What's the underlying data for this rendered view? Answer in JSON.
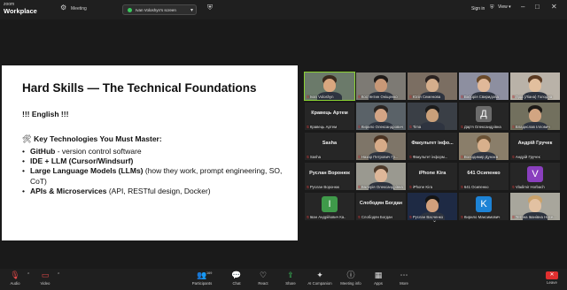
{
  "app": {
    "brand_small": "zoom",
    "brand_big": "Workplace",
    "meeting_label": "Meeting"
  },
  "share_banner": {
    "text": "Ivan Voloshyn's screen"
  },
  "header_right": {
    "signin": "Sign in",
    "view": "View"
  },
  "slide": {
    "title": "Hard Skills — The Technical Foundations",
    "english": "!!! English !!!",
    "subtitle_icon": "🛠",
    "subtitle": "Key Technologies You Must Master:",
    "bullets": [
      {
        "bold": "GitHub",
        "rest": " - version control software"
      },
      {
        "bold": "IDE + LLM (Cursor/Windsurf)",
        "rest": ""
      },
      {
        "bold": "Large Language Models (LLMs)",
        "rest": " (how they work, prompt engineering, SO, CoT)"
      },
      {
        "bold": "APIs & Microservices",
        "rest": " (API, RESTful design, Docker)"
      }
    ]
  },
  "participants": [
    {
      "name": "Ivan Voloshyn",
      "speaker": true
    },
    {
      "name": "Костянтин Оніщенко"
    },
    {
      "name": "Юлія Семенова"
    },
    {
      "name": "Вікторія Свиридова"
    },
    {
      "name": "Ліда (Ліана) Голодна"
    },
    {
      "name": "Кравець Артем",
      "center": "Кравець Артем"
    },
    {
      "name": "Кирило Олександрович"
    },
    {
      "name": "Tima"
    },
    {
      "name": "Дар'я Олександрівна",
      "avatar": "Д"
    },
    {
      "name": "Владислав Іллович"
    },
    {
      "name": "Sasha",
      "center": "Sasha"
    },
    {
      "name": "Назар Петрович Гр..."
    },
    {
      "name": "Факультет інформ...",
      "center": "Факультет інфо..."
    },
    {
      "name": "Володимир Дунаєв"
    },
    {
      "name": "Андрій Гручек",
      "center": "Андрій Гручек"
    },
    {
      "name": "Руслан Воронюк",
      "center": "Руслан Воронюк"
    },
    {
      "name": "Валерія Олександрівна"
    },
    {
      "name": "iPhone Kira",
      "center": "iPhone Kira"
    },
    {
      "name": "641 Осипенко",
      "center": "641 Осипенко"
    },
    {
      "name": "Vladimir Horbach",
      "avatar": "V"
    },
    {
      "name": "Іван Андрійович Ка..",
      "avatar": "I"
    },
    {
      "name": "Слободян Богдан",
      "center": "Слободян Богдан"
    },
    {
      "name": "Руслан Васченко"
    },
    {
      "name": "Кирило Максимович",
      "avatar": "K"
    },
    {
      "name": "Тетяна Іванівна Носе..."
    }
  ],
  "toolbar": {
    "audio": "Audio",
    "video": "Video",
    "participants": "Participants",
    "participants_count": "169",
    "chat": "Chat",
    "react": "React",
    "share": "Share",
    "ai_companion": "AI Companion",
    "meeting_info": "Meeting info",
    "apps": "Apps",
    "more": "More",
    "leave": "Leave"
  },
  "icons": [
    "zoom-logo-icon",
    "gear-icon",
    "shield-icon",
    "minimize-icon",
    "maximize-icon",
    "close-icon",
    "mic-muted-icon",
    "video-off-icon",
    "participants-icon",
    "chat-icon",
    "react-icon",
    "share-icon",
    "ai-companion-icon",
    "info-icon",
    "apps-icon",
    "more-icon",
    "chevron-down-icon"
  ],
  "colors": {
    "speaker_outline": "#8ad232",
    "leave": "#e02f2f",
    "muted": "#e04848",
    "share": "#3ac95e"
  }
}
